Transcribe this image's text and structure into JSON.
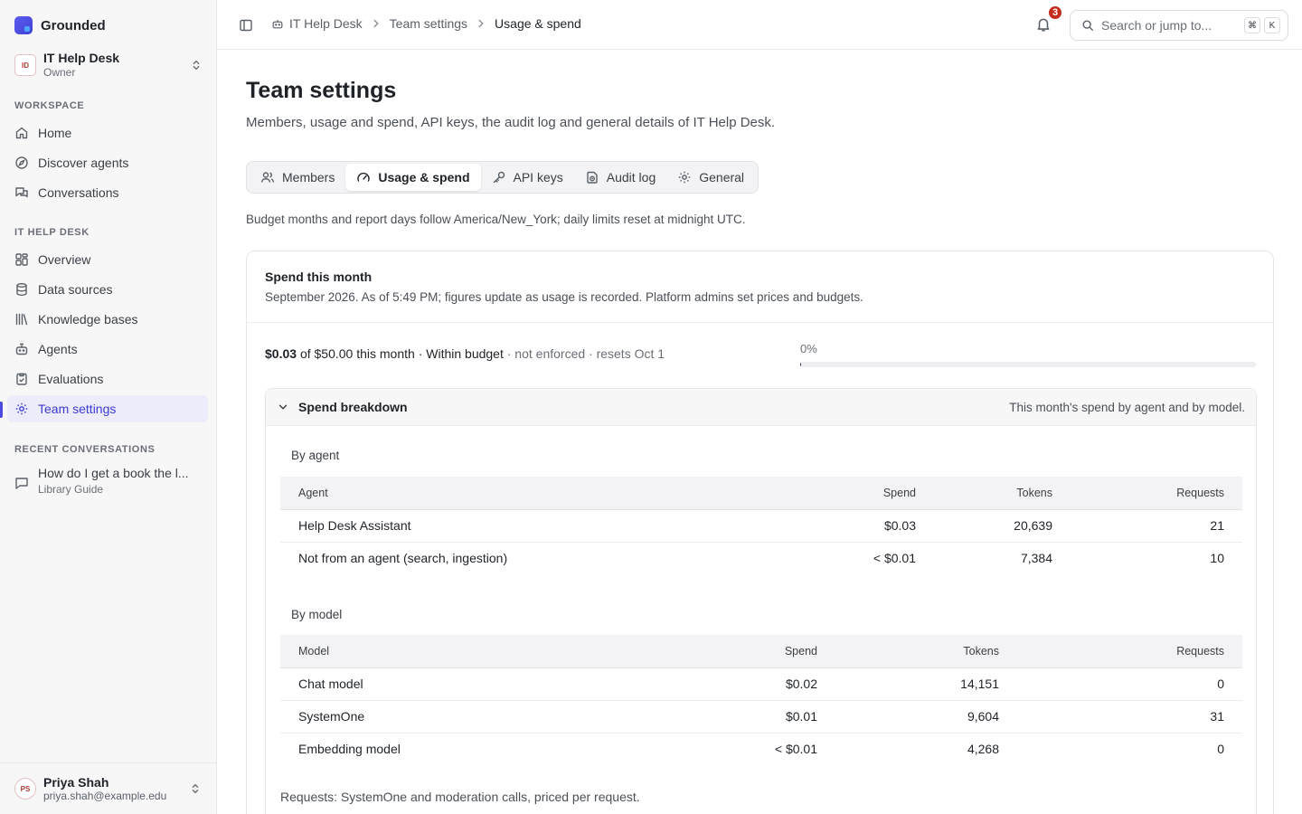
{
  "app": {
    "name": "Grounded"
  },
  "workspace": {
    "name": "IT Help Desk",
    "role": "Owner",
    "initials": "ID"
  },
  "sidebar": {
    "workspace_label": "WORKSPACE",
    "workspace_items": [
      {
        "label": "Home",
        "icon": "home-icon"
      },
      {
        "label": "Discover agents",
        "icon": "compass-icon"
      },
      {
        "label": "Conversations",
        "icon": "chats-icon"
      }
    ],
    "team_label": "IT HELP DESK",
    "team_items": [
      {
        "label": "Overview",
        "icon": "grid-icon"
      },
      {
        "label": "Data sources",
        "icon": "database-icon"
      },
      {
        "label": "Knowledge bases",
        "icon": "library-icon"
      },
      {
        "label": "Agents",
        "icon": "robot-icon"
      },
      {
        "label": "Evaluations",
        "icon": "clipboard-check-icon"
      },
      {
        "label": "Team settings",
        "icon": "gear-icon",
        "active": true
      }
    ],
    "recent_label": "RECENT CONVERSATIONS",
    "recent": [
      {
        "title": "How do I get a book the l...",
        "agent": "Library Guide"
      }
    ]
  },
  "user": {
    "name": "Priya Shah",
    "email": "priya.shah@example.edu",
    "initials": "PS"
  },
  "topbar": {
    "breadcrumbs": [
      "IT Help Desk",
      "Team settings",
      "Usage & spend"
    ],
    "notifications": "3",
    "search_placeholder": "Search or jump to...",
    "shortcut": [
      "⌘",
      "K"
    ]
  },
  "page": {
    "title": "Team settings",
    "subtitle": "Members, usage and spend, API keys, the audit log and general details of IT Help Desk.",
    "tabs": [
      {
        "label": "Members",
        "icon": "users-icon"
      },
      {
        "label": "Usage & spend",
        "icon": "gauge-icon",
        "active": true
      },
      {
        "label": "API keys",
        "icon": "key-icon"
      },
      {
        "label": "Audit log",
        "icon": "log-icon"
      },
      {
        "label": "General",
        "icon": "gear-icon"
      }
    ],
    "tz_note": "Budget months and report days follow America/New_York; daily limits reset at midnight UTC."
  },
  "spend": {
    "title": "Spend this month",
    "description": "September 2026. As of 5:49 PM; figures update as usage is recorded. Platform admins set prices and budgets.",
    "amount": "$0.03",
    "budget_text": "of $50.00 this month · Within budget",
    "budget_muted": "· not enforced · resets Oct 1",
    "percent_label": "0%",
    "percent_value": 0.0006,
    "accent": "#4b4be0"
  },
  "breakdown": {
    "title": "Spend breakdown",
    "note": "This month's spend by agent and by model.",
    "by_agent_label": "By agent",
    "agent_columns": [
      "Agent",
      "Spend",
      "Tokens",
      "Requests"
    ],
    "agent_rows": [
      [
        "Help Desk Assistant",
        "$0.03",
        "20,639",
        "21"
      ],
      [
        "Not from an agent (search, ingestion)",
        "< $0.01",
        "7,384",
        "10"
      ]
    ],
    "by_model_label": "By model",
    "model_columns": [
      "Model",
      "Spend",
      "Tokens",
      "Requests"
    ],
    "model_rows": [
      [
        "Chat model",
        "$0.02",
        "14,151",
        "0"
      ],
      [
        "SystemOne",
        "$0.01",
        "9,604",
        "31"
      ],
      [
        "Embedding model",
        "< $0.01",
        "4,268",
        "0"
      ]
    ],
    "footnote": "Requests: SystemOne and moderation calls, priced per request."
  }
}
